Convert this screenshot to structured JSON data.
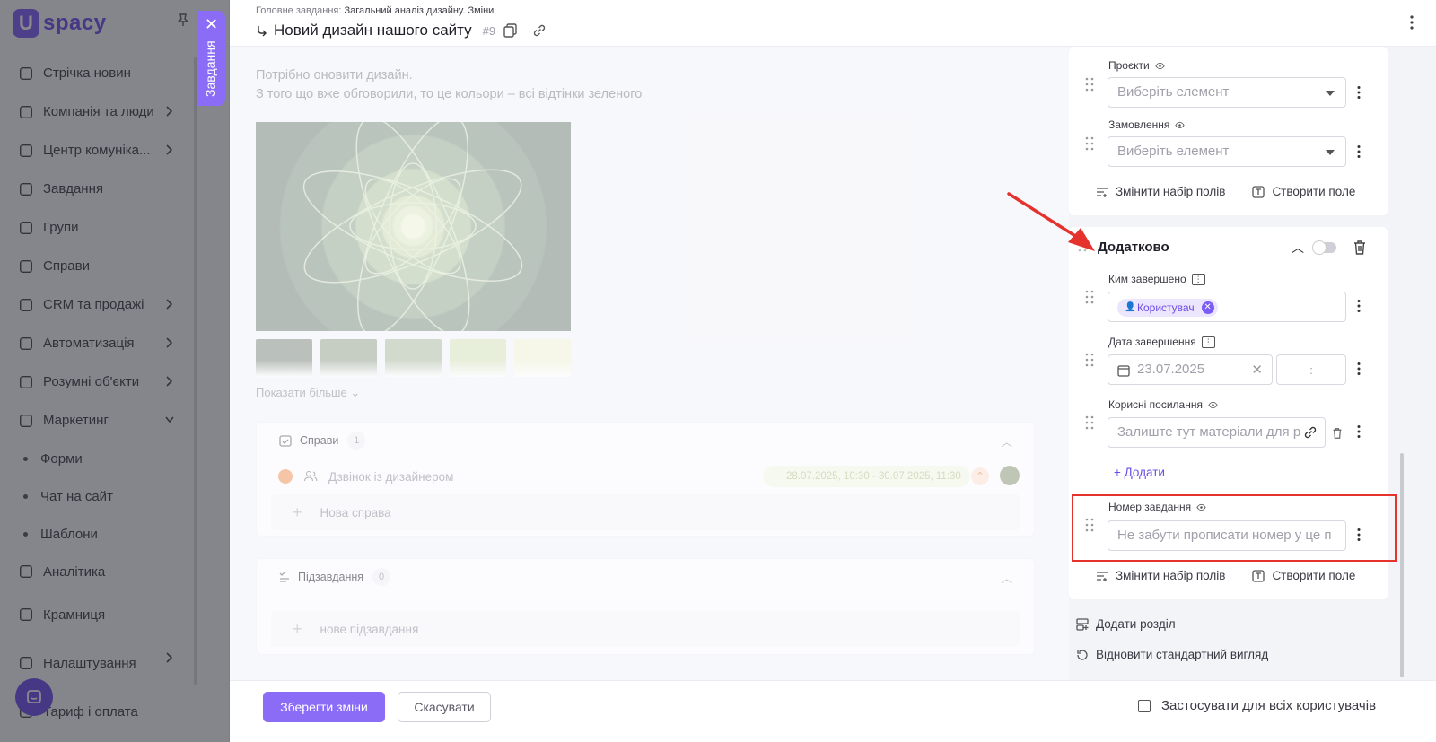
{
  "app": {
    "logo_letter": "U",
    "logo_text": "spacy",
    "task_tab_label": "Завдання"
  },
  "sidebar": {
    "items": [
      {
        "label": "Стрічка новин",
        "icon": "home-icon",
        "has_chevron": false
      },
      {
        "label": "Компанія та люди",
        "icon": "company-icon",
        "has_chevron": true
      },
      {
        "label": "Центр комуніка...",
        "icon": "chat-icon",
        "has_chevron": true
      },
      {
        "label": "Завдання",
        "icon": "task-check-icon",
        "has_chevron": false
      },
      {
        "label": "Групи",
        "icon": "groups-icon",
        "has_chevron": false
      },
      {
        "label": "Справи",
        "icon": "calendar-icon",
        "has_chevron": false
      },
      {
        "label": "CRM та продажі",
        "icon": "crm-icon",
        "has_chevron": true
      },
      {
        "label": "Автоматизація",
        "icon": "lightning-icon",
        "has_chevron": true
      },
      {
        "label": "Розумні об'єкти",
        "icon": "smart-object-icon",
        "has_chevron": true
      },
      {
        "label": "Маркетинг",
        "icon": "marketing-icon",
        "has_chevron": true
      }
    ],
    "marketing_sub": [
      "Форми",
      "Чат на сайт",
      "Шаблони"
    ],
    "items_bottom": [
      {
        "label": "Аналітика",
        "icon": "analytics-icon"
      },
      {
        "label": "Крамниця",
        "icon": "store-icon"
      },
      {
        "label": "Налаштування",
        "icon": "gear-icon"
      },
      {
        "label": "Тариф і оплата",
        "icon": "tariff-icon"
      }
    ]
  },
  "header": {
    "breadcrumb_prefix": "Головне завдання:",
    "breadcrumb_value": "Загальний аналіз дизайну. Зміни",
    "title": "Новий дизайн нашого сайту",
    "number": "#9"
  },
  "description": {
    "line1": "Потрібно оновити дизайн.",
    "line2": "З того що вже обговорили, то це кольори – всі відтінки зеленого"
  },
  "swatch_colors": [
    "#4f5d4c",
    "#6f8268",
    "#8ea47e",
    "#c6d9a0",
    "#eef2c8"
  ],
  "show_more": "Показати більше",
  "deals": {
    "title": "Справи",
    "count": "1",
    "item_label": "Дзвінок із дизайнером",
    "item_time": "28.07.2025, 10:30 - 30.07.2025, 11:30",
    "new_placeholder": "Нова справа"
  },
  "subtasks": {
    "title": "Підзавдання",
    "count": "0",
    "new_placeholder": "нове підзавдання"
  },
  "right": {
    "projects_label": "Проєкти",
    "projects_placeholder": "Виберіть елемент",
    "orders_label": "Замовлення",
    "orders_placeholder": "Виберіть елемент",
    "change_fields": "Змінити набір полів",
    "create_field": "Створити поле",
    "section_title": "Додатково",
    "completed_by_label": "Ким завершено",
    "completed_by_chip": "Користувач",
    "completion_date_label": "Дата завершення",
    "completion_date_value": "23.07.2025",
    "completion_time_value": "-- : --",
    "useful_links_label": "Корисні посилання",
    "useful_links_placeholder": "Залиште тут матеріали для р",
    "add_label": "Додати",
    "task_number_label": "Номер завдання",
    "task_number_placeholder": "Не забути прописати номер у це п",
    "change_fields_2": "Змінити набір полів",
    "create_field_2": "Створити поле",
    "add_section": "Додати розділ",
    "restore_view": "Відновити стандартний вигляд"
  },
  "footer": {
    "save": "Зберегти зміни",
    "cancel": "Скасувати",
    "apply_all": "Застосувати для всіх користувачів"
  },
  "colors": {
    "accent": "#8b6cf7",
    "highlight": "#e5322d"
  }
}
